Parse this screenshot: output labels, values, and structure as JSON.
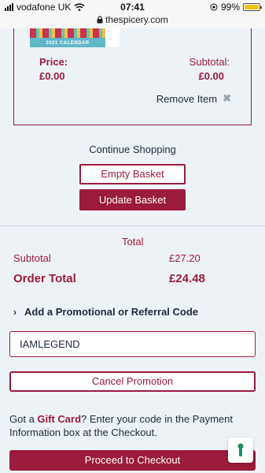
{
  "status_bar": {
    "carrier": "vodafone UK",
    "time": "07:41",
    "battery": "99%",
    "battery_level": 0.99,
    "url": "thespicery.com"
  },
  "basket_item": {
    "thumbnail_caption": "2021 CALENDAR",
    "price_label": "Price:",
    "price_value": "£0.00",
    "subtotal_label": "Subtotal:",
    "subtotal_value": "£0.00",
    "remove_label": "Remove Item"
  },
  "actions": {
    "continue_shopping": "Continue Shopping",
    "empty_basket": "Empty Basket",
    "update_basket": "Update Basket"
  },
  "totals": {
    "heading": "Total",
    "subtotal_label": "Subtotal",
    "subtotal_value": "£27.20",
    "order_total_label": "Order Total",
    "order_total_value": "£24.48"
  },
  "promo": {
    "toggle_label": "Add a Promotional or Referral Code",
    "code_value": "IAMLEGEND",
    "cancel_label": "Cancel Promotion"
  },
  "gift_card": {
    "prefix": "Got a ",
    "highlight": "Gift Card",
    "suffix": "? Enter your code in the Payment Information box at the Checkout."
  },
  "checkout": {
    "label": "Proceed to Checkout"
  },
  "colors": {
    "brand": "#9a1b3c",
    "background": "#edf2f7",
    "text": "#1f2a3a"
  },
  "icons": [
    "signal-icon",
    "wifi-icon",
    "lock-icon",
    "location-icon",
    "battery-icon",
    "remove-x-icon",
    "chevron-right-icon",
    "feedback-icon"
  ]
}
